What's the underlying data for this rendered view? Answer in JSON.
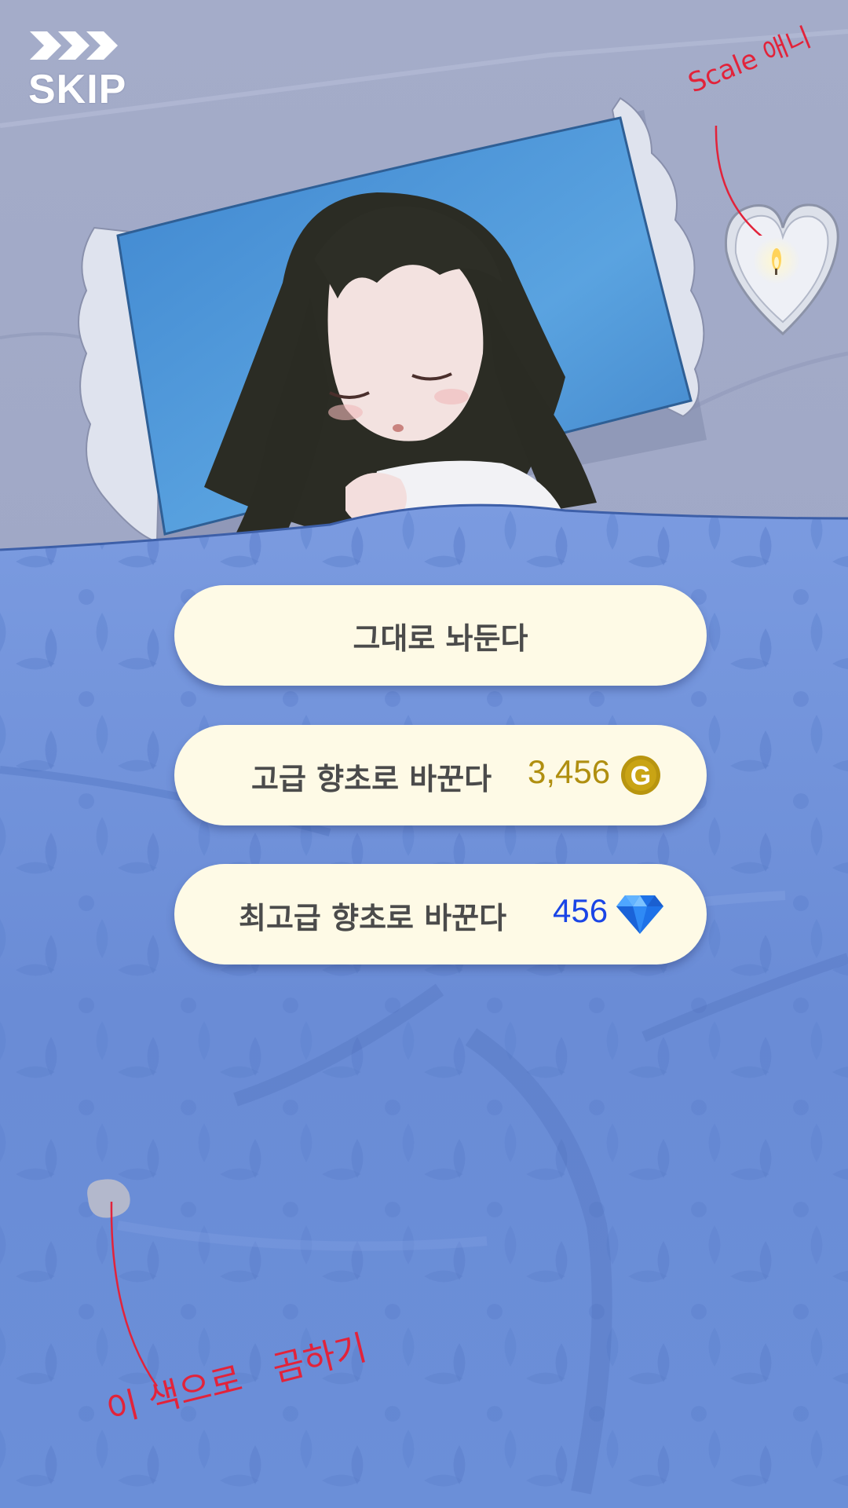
{
  "skip": {
    "label": "SKIP",
    "icon": "fast-forward-chevrons-icon"
  },
  "choices": [
    {
      "label": "그대로 놔둔다"
    },
    {
      "label": "고급 향초로 바꾼다",
      "price": "3,456",
      "currency_icon": "gold-coin-icon",
      "currency_letter": "G",
      "price_color": "#b08f10"
    },
    {
      "label": "최고급 향초로 바꾼다",
      "price": "456",
      "currency_icon": "diamond-icon",
      "price_color": "#1a45e6"
    }
  ],
  "annotations": {
    "candle_note": "Scale 애니",
    "color_note": "이 색으로   곰하기"
  },
  "colors": {
    "button_bg": "#fefae6",
    "button_text": "#4b4b4b",
    "annotation": "#e2233a",
    "sheet": "#a6aecb",
    "blanket": "#6a8ed6",
    "pillow": "#4c93d6",
    "swatch": "#b3b8cc"
  }
}
